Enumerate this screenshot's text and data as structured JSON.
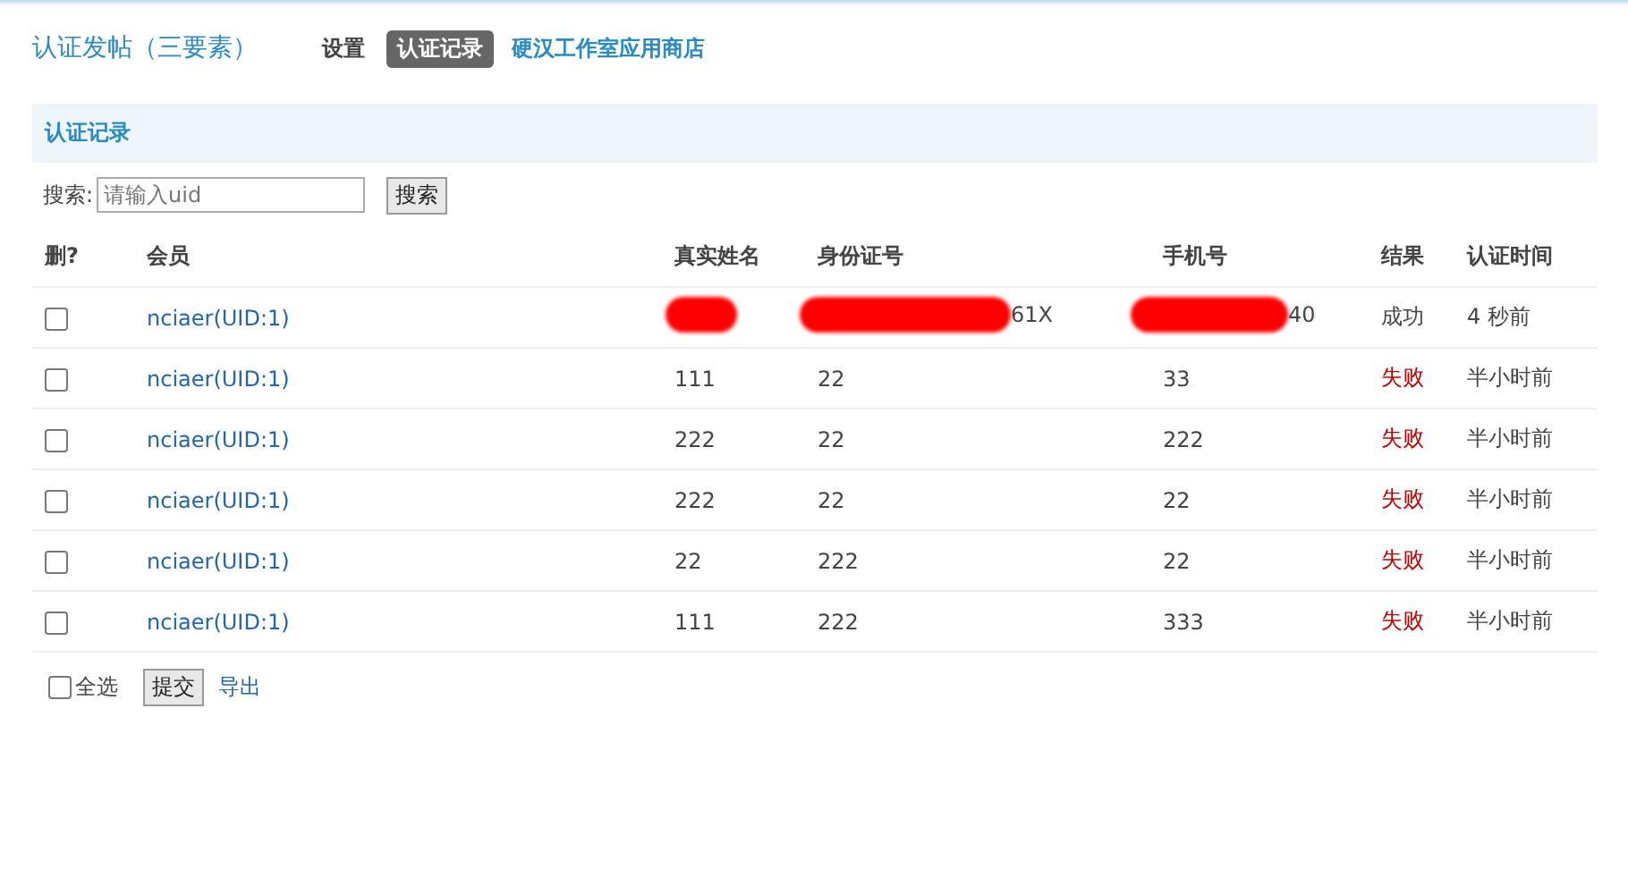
{
  "header": {
    "title": "认证发帖（三要素）",
    "nav": [
      {
        "label": "设置",
        "selected": false,
        "kind": "tab"
      },
      {
        "label": "认证记录",
        "selected": true,
        "kind": "tab"
      },
      {
        "label": "硬汉工作室应用商店",
        "selected": false,
        "kind": "link"
      }
    ]
  },
  "section": {
    "title": "认证记录"
  },
  "search": {
    "label": "搜索:",
    "placeholder": "请输入uid",
    "button": "搜索"
  },
  "table": {
    "columns": [
      "删?",
      "会员",
      "真实姓名",
      "身份证号",
      "手机号",
      "结果",
      "认证时间"
    ],
    "rows": [
      {
        "checked": false,
        "member": "nciaer(UID:1)",
        "name": {
          "redacted": true
        },
        "id_number": {
          "text": "61X",
          "redacted": true
        },
        "phone": {
          "text": "40",
          "redacted": true
        },
        "result": {
          "text": "成功",
          "color": "#444444"
        },
        "time": "4 秒前"
      },
      {
        "checked": false,
        "member": "nciaer(UID:1)",
        "name": {
          "text": "111",
          "redacted": false
        },
        "id_number": {
          "text": "22",
          "redacted": false
        },
        "phone": {
          "text": "33",
          "redacted": false
        },
        "result": {
          "text": "失败",
          "color": "#c00000"
        },
        "time": "半小时前"
      },
      {
        "checked": false,
        "member": "nciaer(UID:1)",
        "name": {
          "text": "222",
          "redacted": false
        },
        "id_number": {
          "text": "22",
          "redacted": false
        },
        "phone": {
          "text": "222",
          "redacted": false
        },
        "result": {
          "text": "失败",
          "color": "#c00000"
        },
        "time": "半小时前"
      },
      {
        "checked": false,
        "member": "nciaer(UID:1)",
        "name": {
          "text": "222",
          "redacted": false
        },
        "id_number": {
          "text": "22",
          "redacted": false
        },
        "phone": {
          "text": "22",
          "redacted": false
        },
        "result": {
          "text": "失败",
          "color": "#c00000"
        },
        "time": "半小时前"
      },
      {
        "checked": false,
        "member": "nciaer(UID:1)",
        "name": {
          "text": "22",
          "redacted": false
        },
        "id_number": {
          "text": "222",
          "redacted": false
        },
        "phone": {
          "text": "22",
          "redacted": false
        },
        "result": {
          "text": "失败",
          "color": "#c00000"
        },
        "time": "半小时前"
      },
      {
        "checked": false,
        "member": "nciaer(UID:1)",
        "name": {
          "text": "111",
          "redacted": false
        },
        "id_number": {
          "text": "222",
          "redacted": false
        },
        "phone": {
          "text": "333",
          "redacted": false
        },
        "result": {
          "text": "失败",
          "color": "#c00000"
        },
        "time": "半小时前"
      }
    ]
  },
  "footer": {
    "select_all": {
      "label": "全选",
      "checked": false
    },
    "submit": "提交",
    "export": "导出"
  }
}
